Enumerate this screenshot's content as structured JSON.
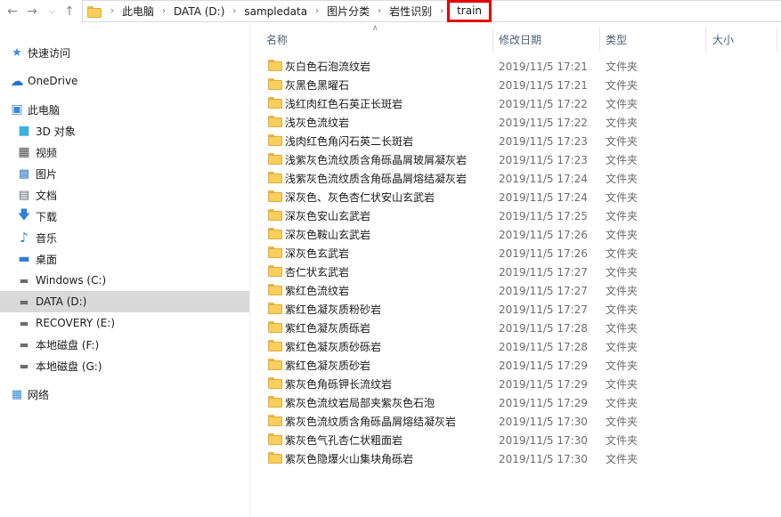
{
  "address": {
    "crumbs": [
      "此电脑",
      "DATA (D:)",
      "sampledata",
      "图片分类",
      "岩性识别",
      "train"
    ]
  },
  "sidebar": {
    "items": [
      {
        "label": "快速访问",
        "icon": "star-icon",
        "indent": 0
      },
      {
        "label": "OneDrive",
        "icon": "cloud-icon",
        "indent": 0
      },
      {
        "label": "此电脑",
        "icon": "computer-icon",
        "indent": 0
      },
      {
        "label": "3D 对象",
        "icon": "cube-icon",
        "indent": 1
      },
      {
        "label": "视频",
        "icon": "video-icon",
        "indent": 1
      },
      {
        "label": "图片",
        "icon": "picture-icon",
        "indent": 1
      },
      {
        "label": "文档",
        "icon": "document-icon",
        "indent": 1
      },
      {
        "label": "下载",
        "icon": "download-icon",
        "indent": 1
      },
      {
        "label": "音乐",
        "icon": "music-icon",
        "indent": 1
      },
      {
        "label": "桌面",
        "icon": "desktop-icon",
        "indent": 1
      },
      {
        "label": "Windows (C:)",
        "icon": "drive-icon",
        "indent": 1
      },
      {
        "label": "DATA (D:)",
        "icon": "drive-icon",
        "indent": 1
      },
      {
        "label": "RECOVERY (E:)",
        "icon": "drive-icon",
        "indent": 1
      },
      {
        "label": "本地磁盘 (F:)",
        "icon": "drive-icon",
        "indent": 1
      },
      {
        "label": "本地磁盘 (G:)",
        "icon": "drive-icon",
        "indent": 1
      },
      {
        "label": "网络",
        "icon": "network-icon",
        "indent": 0
      }
    ],
    "selected": "DATA (D:)"
  },
  "columns": {
    "name": "名称",
    "date": "修改日期",
    "type": "类型",
    "size": "大小"
  },
  "files": [
    {
      "name": "灰白色石泡流纹岩",
      "date": "2019/11/5 17:21",
      "type": "文件夹"
    },
    {
      "name": "灰黑色黑曜石",
      "date": "2019/11/5 17:21",
      "type": "文件夹"
    },
    {
      "name": "浅红肉红色石英正长斑岩",
      "date": "2019/11/5 17:22",
      "type": "文件夹"
    },
    {
      "name": "浅灰色流纹岩",
      "date": "2019/11/5 17:22",
      "type": "文件夹"
    },
    {
      "name": "浅肉红色角闪石英二长斑岩",
      "date": "2019/11/5 17:23",
      "type": "文件夹"
    },
    {
      "name": "浅紫灰色流纹质含角砾晶屑玻屑凝灰岩",
      "date": "2019/11/5 17:23",
      "type": "文件夹"
    },
    {
      "name": "浅紫灰色流纹质含角砾晶屑熔结凝灰岩",
      "date": "2019/11/5 17:24",
      "type": "文件夹"
    },
    {
      "name": "深灰色、灰色杏仁状安山玄武岩",
      "date": "2019/11/5 17:24",
      "type": "文件夹"
    },
    {
      "name": "深灰色安山玄武岩",
      "date": "2019/11/5 17:25",
      "type": "文件夹"
    },
    {
      "name": "深灰色鞍山玄武岩",
      "date": "2019/11/5 17:26",
      "type": "文件夹"
    },
    {
      "name": "深灰色玄武岩",
      "date": "2019/11/5 17:26",
      "type": "文件夹"
    },
    {
      "name": "杏仁状玄武岩",
      "date": "2019/11/5 17:27",
      "type": "文件夹"
    },
    {
      "name": "紫红色流纹岩",
      "date": "2019/11/5 17:27",
      "type": "文件夹"
    },
    {
      "name": "紫红色凝灰质粉砂岩",
      "date": "2019/11/5 17:27",
      "type": "文件夹"
    },
    {
      "name": "紫红色凝灰质砾岩",
      "date": "2019/11/5 17:28",
      "type": "文件夹"
    },
    {
      "name": "紫红色凝灰质砂砾岩",
      "date": "2019/11/5 17:28",
      "type": "文件夹"
    },
    {
      "name": "紫红色凝灰质砂岩",
      "date": "2019/11/5 17:29",
      "type": "文件夹"
    },
    {
      "name": "紫灰色角砾钾长流纹岩",
      "date": "2019/11/5 17:29",
      "type": "文件夹"
    },
    {
      "name": "紫灰色流纹岩局部夹紫灰色石泡",
      "date": "2019/11/5 17:29",
      "type": "文件夹"
    },
    {
      "name": "紫灰色流纹质含角砾晶屑熔结凝灰岩",
      "date": "2019/11/5 17:30",
      "type": "文件夹"
    },
    {
      "name": "紫灰色气孔杏仁状粗面岩",
      "date": "2019/11/5 17:30",
      "type": "文件夹"
    },
    {
      "name": "紫灰色隐爆火山集块角砾岩",
      "date": "2019/11/5 17:30",
      "type": "文件夹"
    }
  ],
  "colors": {
    "highlight_border": "#e50000",
    "selected_bg": "#d9d9d9",
    "folder_yellow": "#f6cf5e",
    "header_text": "#4c607a"
  }
}
